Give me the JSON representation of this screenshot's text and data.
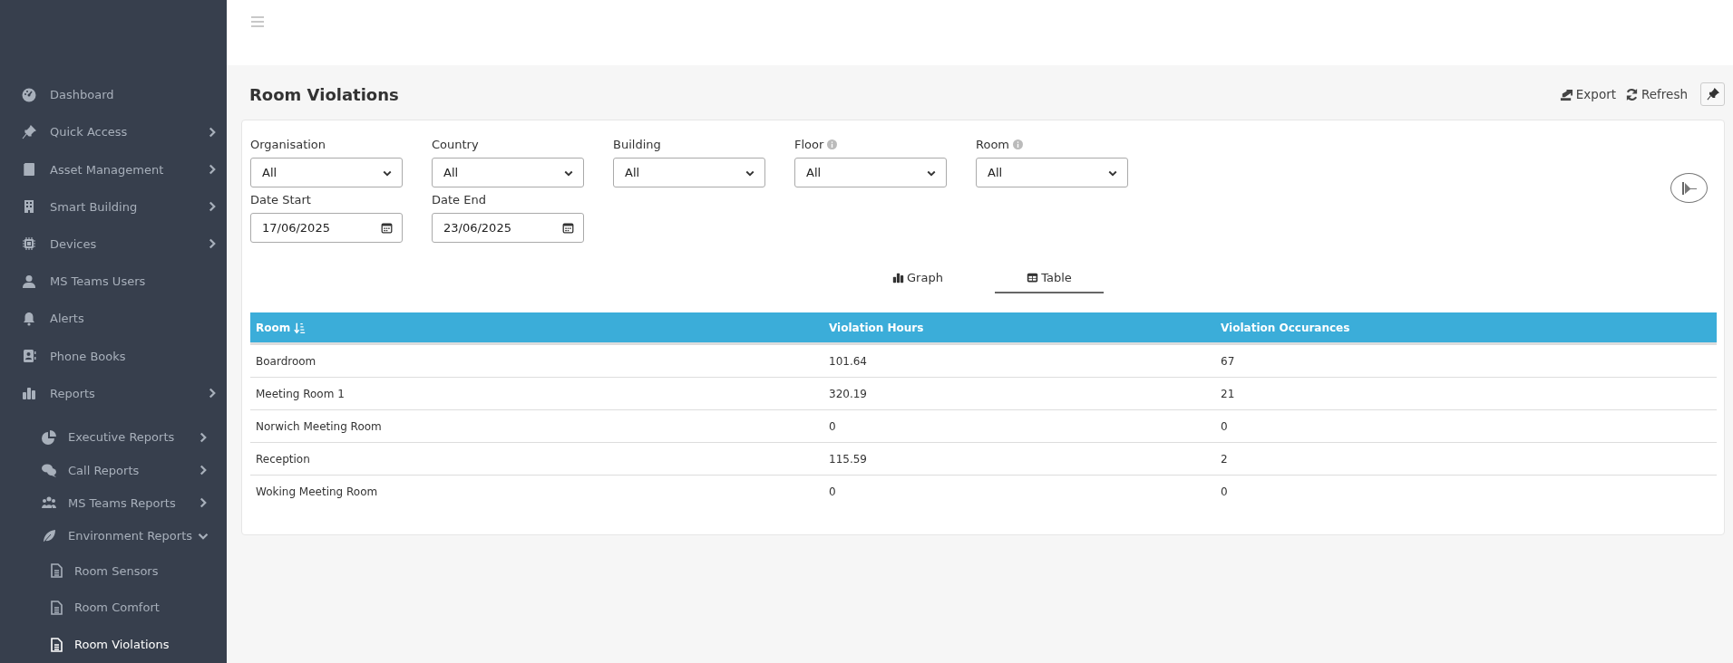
{
  "sidebar": {
    "items": [
      {
        "label": "Dashboard",
        "selected": false
      },
      {
        "label": "Quick Access",
        "selected": false,
        "expanded": false
      },
      {
        "label": "Asset Management",
        "selected": false,
        "expanded": false
      },
      {
        "label": "Smart Building",
        "selected": false,
        "expanded": false
      },
      {
        "label": "Devices",
        "selected": false,
        "expanded": false
      },
      {
        "label": "MS Teams Users",
        "selected": false
      },
      {
        "label": "Alerts",
        "selected": false
      },
      {
        "label": "Phone Books",
        "selected": false
      },
      {
        "label": "Reports",
        "selected": false,
        "expanded": false,
        "children": [
          {
            "label": "Executive Reports",
            "selected": false,
            "expanded": false
          },
          {
            "label": "Call Reports",
            "selected": false,
            "expanded": false
          },
          {
            "label": "MS Teams Reports",
            "selected": false,
            "expanded": false
          },
          {
            "label": "Environment Reports",
            "selected": false,
            "expanded": true,
            "children": [
              {
                "label": "Room Sensors",
                "selected": false
              },
              {
                "label": "Room Comfort",
                "selected": false
              },
              {
                "label": "Room Violations",
                "selected": true
              }
            ]
          }
        ]
      }
    ]
  },
  "page": {
    "title": "Room Violations",
    "actions": [
      {
        "label": "Export"
      },
      {
        "label": "Refresh"
      }
    ]
  },
  "filters": [
    [
      {
        "kind": "select",
        "label": "Organisation",
        "value": "All",
        "info": false
      },
      {
        "kind": "select",
        "label": "Country",
        "value": "All",
        "info": false
      },
      {
        "kind": "select",
        "label": "Building",
        "value": "All",
        "info": false
      },
      {
        "kind": "select",
        "label": "Floor",
        "value": "All",
        "info": true
      },
      {
        "kind": "select",
        "label": "Room",
        "value": "All",
        "info": true
      }
    ],
    [
      {
        "kind": "date",
        "label": "Date Start",
        "value": "17/06/2025",
        "info": false
      },
      {
        "kind": "date",
        "label": "Date End",
        "value": "23/06/2025",
        "info": false
      }
    ]
  ],
  "tabs": [
    {
      "label": "Graph",
      "selected": false
    },
    {
      "label": "Table",
      "selected": true
    }
  ],
  "table": {
    "columns": [
      {
        "label": "Room",
        "sorted": true
      },
      {
        "label": "Violation Hours",
        "sorted": false
      },
      {
        "label": "Violation Occurances",
        "sorted": false
      }
    ],
    "rows": [
      [
        "Boardroom",
        "101.64",
        "67"
      ],
      [
        "Meeting Room 1",
        "320.19",
        "21"
      ],
      [
        "Norwich Meeting Room",
        "0",
        "0"
      ],
      [
        "Reception",
        "115.59",
        "2"
      ],
      [
        "Woking Meeting Room",
        "0",
        "0"
      ]
    ]
  }
}
